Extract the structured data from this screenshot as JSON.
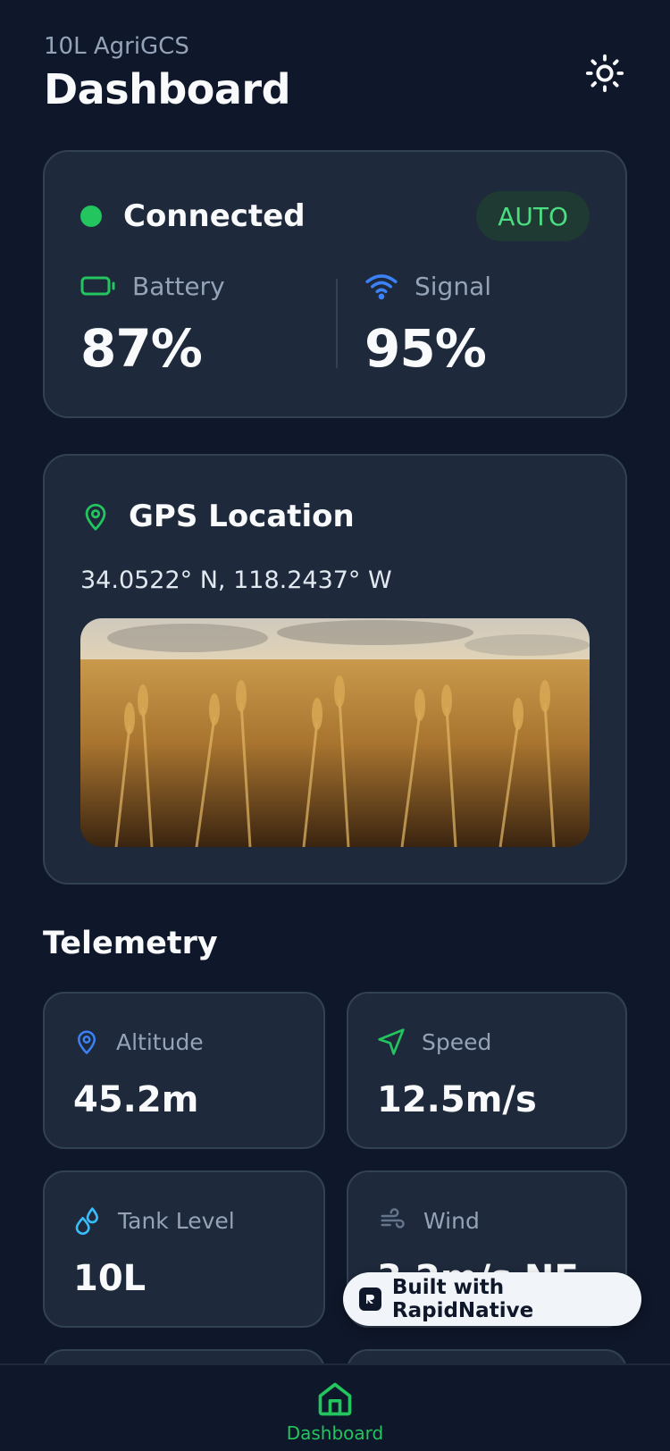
{
  "header": {
    "app_name": "10L AgriGCS",
    "title": "Dashboard",
    "theme_icon": "sun-icon"
  },
  "status": {
    "connection": "Connected",
    "mode": "AUTO",
    "battery_label": "Battery",
    "battery_value": "87%",
    "signal_label": "Signal",
    "signal_value": "95%"
  },
  "gps": {
    "title": "GPS Location",
    "coordinates": "34.0522° N, 118.2437° W"
  },
  "telemetry": {
    "title": "Telemetry",
    "tiles": [
      {
        "label": "Altitude",
        "value": "45.2m",
        "icon": "location-pin-icon"
      },
      {
        "label": "Speed",
        "value": "12.5m/s",
        "icon": "navigation-arrow-icon"
      },
      {
        "label": "Tank Level",
        "value": "10L",
        "icon": "droplets-icon"
      },
      {
        "label": "Wind",
        "value": "3.2m/s NE",
        "icon": "wind-icon"
      }
    ]
  },
  "badge": {
    "text": "Built with RapidNative"
  },
  "nav": {
    "dashboard_label": "Dashboard"
  },
  "colors": {
    "background": "#0f172a",
    "card": "#1e293b",
    "accent_green": "#22c55e",
    "accent_blue": "#3b82f6",
    "accent_cyan": "#38bdf8"
  }
}
